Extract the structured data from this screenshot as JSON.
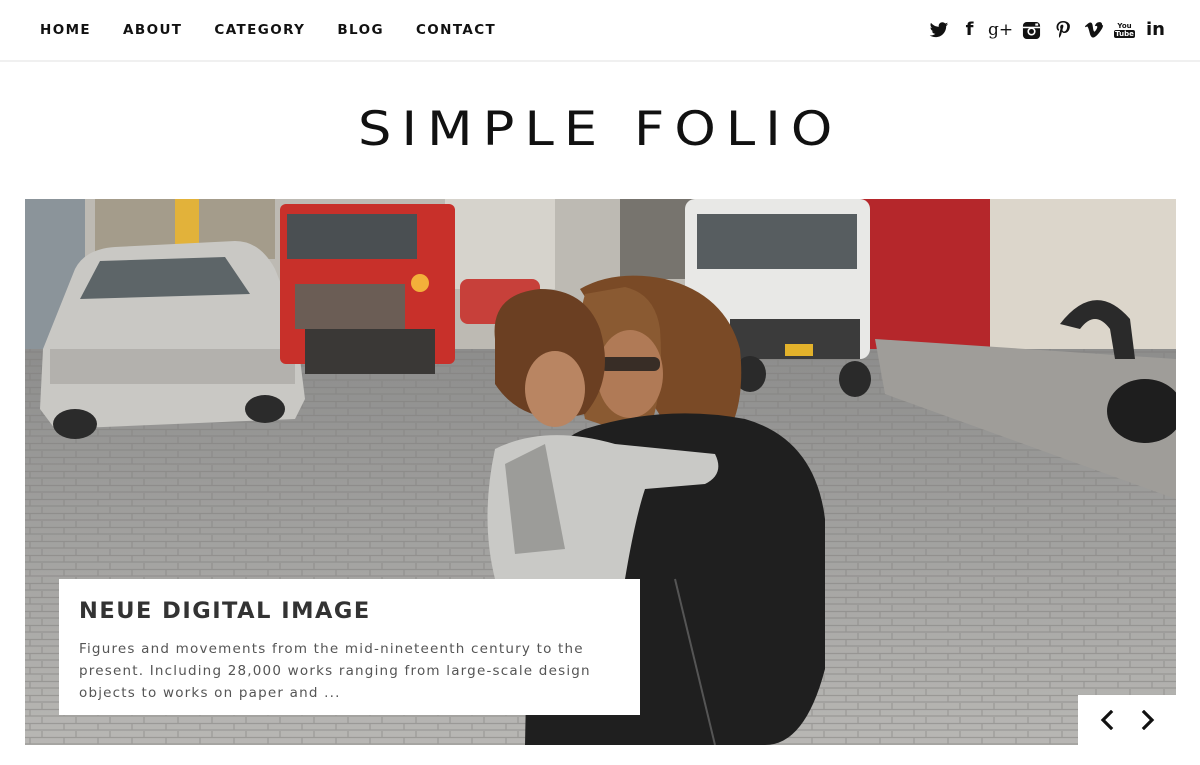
{
  "nav": {
    "items": [
      {
        "label": "HOME"
      },
      {
        "label": "ABOUT"
      },
      {
        "label": "CATEGORY"
      },
      {
        "label": "BLOG"
      },
      {
        "label": "CONTACT"
      }
    ]
  },
  "social": {
    "icons": [
      "twitter-icon",
      "facebook-icon",
      "google-plus-icon",
      "instagram-icon",
      "pinterest-icon",
      "vimeo-icon",
      "youtube-icon",
      "linkedin-icon"
    ],
    "youtube_top": "You",
    "youtube_bottom": "Tube",
    "linkedin_text": "in",
    "facebook_text": "f",
    "gplus_text": "g+"
  },
  "site": {
    "title": "SIMPLE FOLIO"
  },
  "slider": {
    "title": "NEUE DIGITAL IMAGE",
    "excerpt": "Figures and movements from the mid-nineteenth century to the present. Including 28,000 works ranging from large-scale design objects to works on paper and ...",
    "prev_icon": "chevron-left-icon",
    "next_icon": "chevron-right-icon"
  },
  "colors": {
    "text": "#111111",
    "caption_bg": "#ffffff",
    "truck_red": "#c8302a"
  }
}
